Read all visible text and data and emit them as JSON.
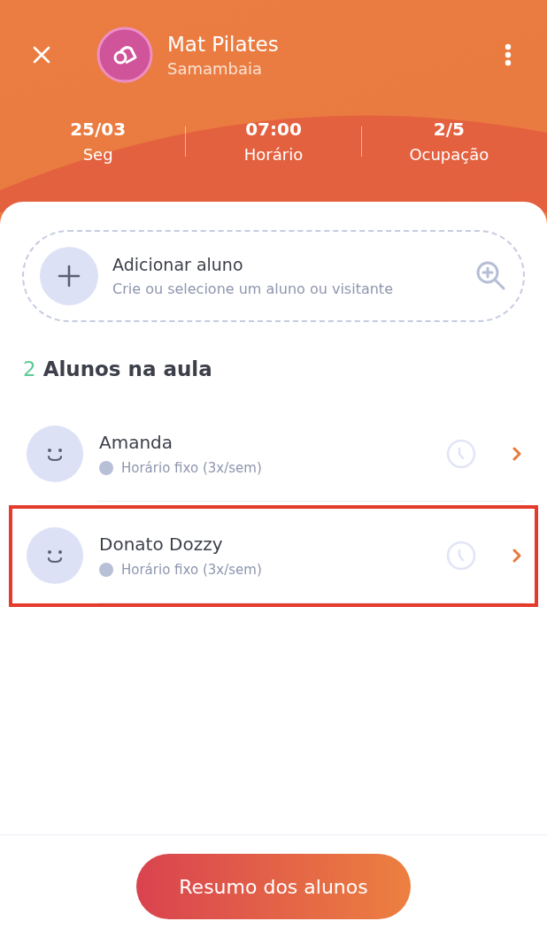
{
  "header": {
    "title": "Mat Pilates",
    "subtitle": "Samambaia"
  },
  "stats": [
    {
      "value": "25/03",
      "label": "Seg"
    },
    {
      "value": "07:00",
      "label": "Horário"
    },
    {
      "value": "2/5",
      "label": "Ocupação"
    }
  ],
  "add_student": {
    "title": "Adicionar aluno",
    "subtitle": "Crie ou selecione um aluno ou visitante"
  },
  "section": {
    "count": "2",
    "title": "Alunos na aula"
  },
  "students": [
    {
      "name": "Amanda",
      "plan": "Horário fixo (3x/sem)",
      "color": "#b8c0d8",
      "highlighted": false
    },
    {
      "name": "Donato Dozzy",
      "plan": "Horário fixo (3x/sem)",
      "color": "#b8c0d8",
      "highlighted": true
    }
  ],
  "footer_button": "Resumo dos alunos"
}
